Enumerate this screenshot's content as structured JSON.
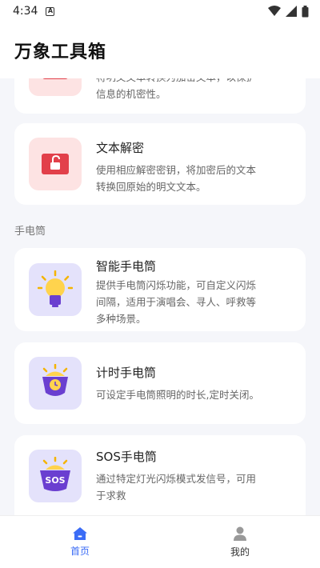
{
  "status_bar": {
    "time": "4:34"
  },
  "header": {
    "title": "万象工具箱"
  },
  "cards_top": [
    {
      "desc_partial_line1": "将明文文本转换为加密文本，以保护",
      "desc_partial_line2": "信息的机密性。",
      "icon": "lock-icon"
    },
    {
      "title": "文本解密",
      "desc_line1": "使用相应解密密钥，将加密后的文本",
      "desc_line2": "转换回原始的明文文本。",
      "icon": "unlock-icon"
    }
  ],
  "section": {
    "label": "手电筒"
  },
  "flashlight_cards": [
    {
      "title": "智能手电筒",
      "desc_line1": "提供手电筒闪烁功能，可自定义闪烁",
      "desc_line2": "间隔，适用于演唱会、寻人、呼救等",
      "desc_line3": "多种场景。",
      "icon": "lightbulb-icon"
    },
    {
      "title": "计时手电筒",
      "desc_line1": "可设定手电筒照明的时长,定时关闭。",
      "icon": "timer-flashlight-icon"
    },
    {
      "title": "SOS手电筒",
      "desc_line1": "通过特定灯光闪烁模式发信号，可用",
      "desc_line2": "于求救",
      "icon": "sos-flashlight-icon",
      "badge": "SOS"
    }
  ],
  "bottom_nav": {
    "home_label": "首页",
    "mine_label": "我的"
  },
  "colors": {
    "accent": "#3b6cf6",
    "red_icon": "#e2404a",
    "purple_icon": "#6a3fd0"
  }
}
